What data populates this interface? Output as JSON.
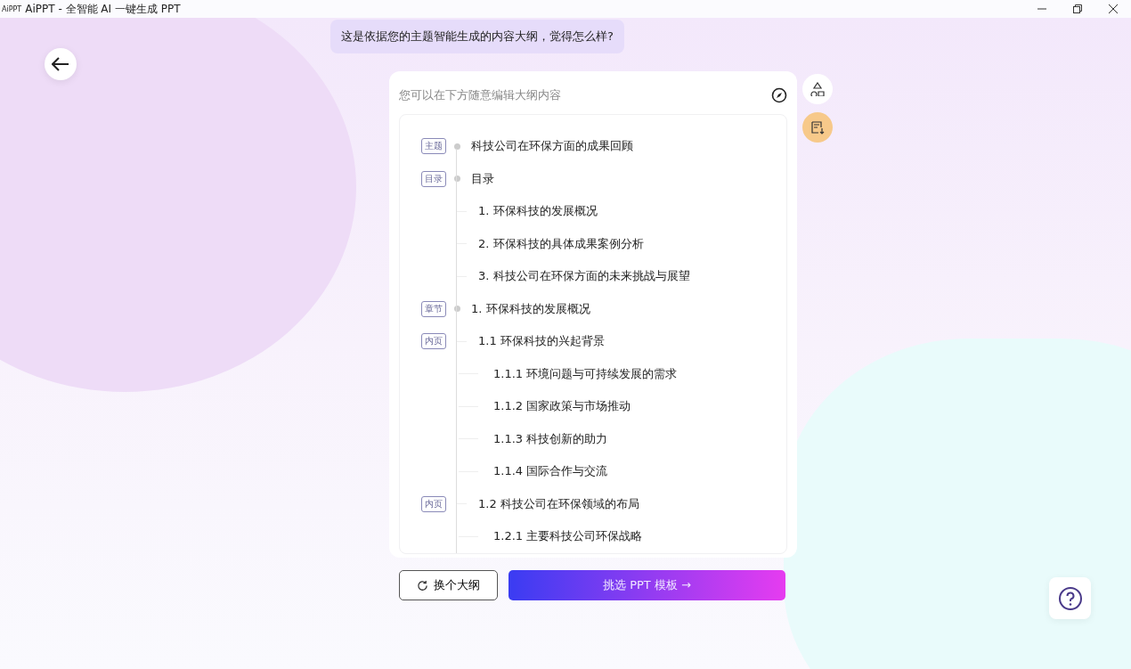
{
  "window": {
    "app_label": "AiPPT",
    "title": "AiPPT - 全智能 AI 一键生成 PPT"
  },
  "chat_bubble": "这是依据您的主题智能生成的内容大纲，觉得怎么样?",
  "outline_card": {
    "hint": "您可以在下方随意编辑大纲内容",
    "items": [
      {
        "tag": "主题",
        "text": "科技公司在环保方面的成果回顾"
      },
      {
        "tag": "目录",
        "text": "目录",
        "children": [
          {
            "text": "1. 环保科技的发展概况"
          },
          {
            "text": "2. 环保科技的具体成果案例分析"
          },
          {
            "text": "3. 科技公司在环保方面的未来挑战与展望"
          }
        ]
      },
      {
        "tag": "章节",
        "text": "1. 环保科技的发展概况",
        "children": [
          {
            "tag": "内页",
            "text": "1.1 环保科技的兴起背景",
            "children": [
              {
                "text": "1.1.1 环境问题与可持续发展的需求"
              },
              {
                "text": "1.1.2 国家政策与市场推动"
              },
              {
                "text": "1.1.3 科技创新的助力"
              },
              {
                "text": "1.1.4 国际合作与交流"
              }
            ]
          },
          {
            "tag": "内页",
            "text": "1.2 科技公司在环保领域的布局",
            "children": [
              {
                "text": "1.2.1 主要科技公司环保战略"
              }
            ]
          }
        ]
      }
    ]
  },
  "buttons": {
    "change": "换个大纲",
    "choose": "挑选 PPT 模板 →"
  }
}
